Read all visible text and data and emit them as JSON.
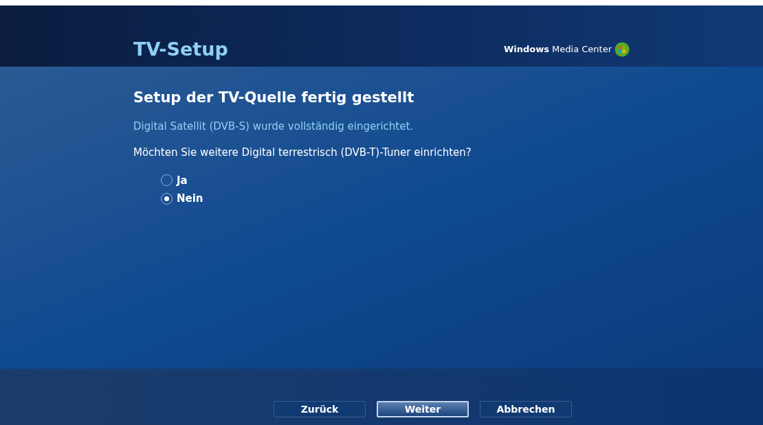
{
  "header": {
    "title": "TV-Setup",
    "brand": "**Windows** Media Center"
  },
  "heading": "Setup der TV-Quelle fertig gestellt",
  "status": "Digital Satellit (DVB-S) wurde vollständig eingerichtet.",
  "question": "Möchten Sie weitere Digital terrestrisch (DVB-T)-Tuner einrichten?",
  "options": [
    {
      "label": "Ja",
      "selected": false
    },
    {
      "label": "Nein",
      "selected": true
    }
  ],
  "buttons": [
    {
      "label": "Zurück",
      "focused": false
    },
    {
      "label": "Weiter",
      "focused": true
    },
    {
      "label": "Abbrechen",
      "focused": false
    }
  ]
}
